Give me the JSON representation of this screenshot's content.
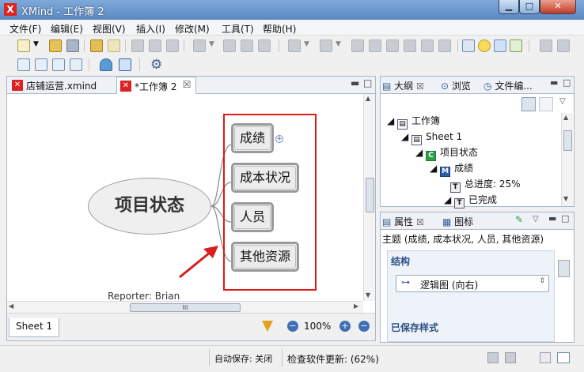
{
  "window": {
    "title": "XMind - 工作簿 2",
    "logo": "X"
  },
  "menu": [
    "文件(F)",
    "编辑(E)",
    "视图(V)",
    "插入(I)",
    "修改(M)",
    "工具(T)",
    "帮助(H)"
  ],
  "editor": {
    "tabs": [
      {
        "label": "店铺运营.xmind",
        "active": false
      },
      {
        "label": "*工作簿 2",
        "active": true
      }
    ],
    "central_topic": "项目状态",
    "subtopics": [
      "成绩",
      "成本状况",
      "人员",
      "其他资源"
    ],
    "footer_label": "Reporter: Brian",
    "sheet_tab": "Sheet 1",
    "zoom": "100%",
    "hscroll_grip": "III"
  },
  "outline": {
    "tabs": [
      "大纲",
      "浏览",
      "文件编..."
    ],
    "rows": [
      {
        "label": "工作簿",
        "icon": "workbook-icon",
        "badge": "",
        "indent": 0
      },
      {
        "label": "Sheet 1",
        "icon": "sheet-icon",
        "badge": "",
        "indent": 1
      },
      {
        "label": "项目状态",
        "icon": "central-topic-icon",
        "badge": "C",
        "indent": 2
      },
      {
        "label": "成绩",
        "icon": "main-topic-icon",
        "badge": "M",
        "indent": 3
      },
      {
        "label": "总进度: 25%",
        "icon": "text-topic-icon",
        "badge": "T",
        "indent": 4
      },
      {
        "label": "已完成",
        "icon": "text-topic-icon",
        "badge": "T",
        "indent": 4
      }
    ]
  },
  "properties": {
    "tabs": [
      "属性",
      "图标"
    ],
    "topic_line": "主题 (成绩, 成本状况, 人员, 其他资源)",
    "structure_header": "结构",
    "structure_value": "逻辑图 (向右)",
    "saved_styles_header": "已保存样式"
  },
  "status": {
    "autosave": "自动保存: 关闭",
    "update": "检查软件更新: (62%)"
  },
  "colors": {
    "highlight": "#e01818",
    "arrow": "#d81e1e",
    "title_bar": "#5b88c5"
  }
}
